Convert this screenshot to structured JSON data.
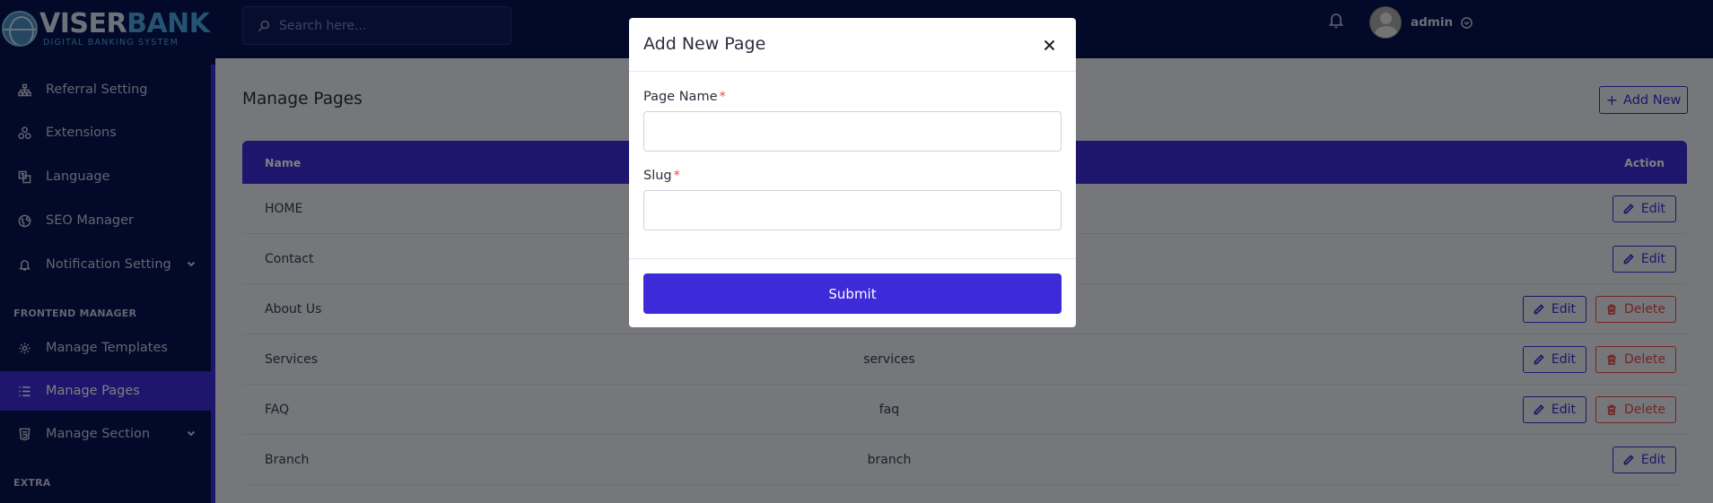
{
  "brand": {
    "logo_main_1": "VISER",
    "logo_main_2": "BANK",
    "logo_sub": "DIGITAL BANKING SYSTEM"
  },
  "sidebar": {
    "items": [
      {
        "label": "Referral Setting",
        "icon": "hierarchy-icon"
      },
      {
        "label": "Extensions",
        "icon": "puzzle-icon"
      },
      {
        "label": "Language",
        "icon": "language-icon"
      },
      {
        "label": "SEO Manager",
        "icon": "globe-icon"
      },
      {
        "label": "Notification Setting",
        "icon": "bell-icon",
        "has_submenu": true
      }
    ],
    "section_frontend": "FRONTEND MANAGER",
    "frontend_items": [
      {
        "label": "Manage Templates",
        "icon": "gear-icon"
      },
      {
        "label": "Manage Pages",
        "icon": "list-icon",
        "active": true
      },
      {
        "label": "Manage Section",
        "icon": "html-icon",
        "has_submenu": true
      }
    ],
    "section_extra": "EXTRA"
  },
  "topbar": {
    "search_placeholder": "Search here...",
    "user_name": "admin"
  },
  "main": {
    "title": "Manage Pages",
    "add_new_label": "Add New",
    "table": {
      "headers": {
        "name": "Name",
        "action": "Action"
      },
      "rows": [
        {
          "name": "HOME",
          "slug": "",
          "edit": "Edit",
          "delete": ""
        },
        {
          "name": "Contact",
          "slug": "",
          "edit": "Edit",
          "delete": ""
        },
        {
          "name": "About Us",
          "slug": "",
          "edit": "Edit",
          "delete": "Delete"
        },
        {
          "name": "Services",
          "slug": "services",
          "edit": "Edit",
          "delete": "Delete"
        },
        {
          "name": "FAQ",
          "slug": "faq",
          "edit": "Edit",
          "delete": "Delete"
        },
        {
          "name": "Branch",
          "slug": "branch",
          "edit": "Edit",
          "delete": ""
        }
      ]
    }
  },
  "modal": {
    "title": "Add New Page",
    "page_name_label": "Page Name",
    "slug_label": "Slug",
    "required_mark": "*",
    "page_name_value": "",
    "slug_value": "",
    "submit_label": "Submit"
  },
  "colors": {
    "sidebar_bg": "#071251",
    "accent": "#3d2ad8",
    "danger": "#e44b4b",
    "page_bg": "#eceef5"
  }
}
